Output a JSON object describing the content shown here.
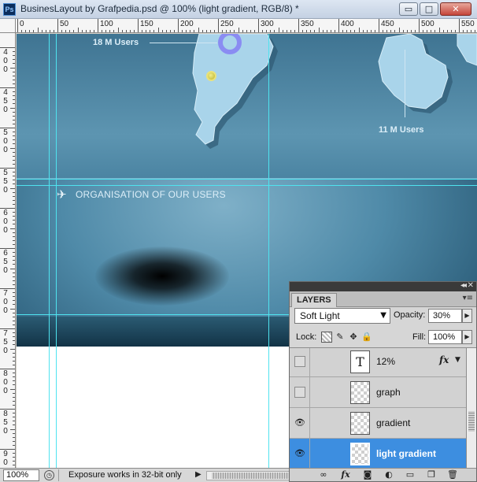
{
  "window": {
    "app_icon": "Ps",
    "title": "BusinesLayout by Grafpedia.psd @ 100% (light gradient, RGB/8) *",
    "minimize_glyph": "▭",
    "maximize_glyph": "□",
    "close_glyph": "✕"
  },
  "rulers": {
    "top_labels": [
      "0",
      "50",
      "100",
      "150",
      "200",
      "250",
      "300",
      "350",
      "400",
      "450",
      "500",
      "550"
    ],
    "left_labels": [
      [
        "4",
        "0",
        "0"
      ],
      [
        "4",
        "5",
        "0"
      ],
      [
        "5",
        "0",
        "0"
      ],
      [
        "5",
        "5",
        "0"
      ],
      [
        "6",
        "0",
        "0"
      ],
      [
        "6",
        "5",
        "0"
      ],
      [
        "7",
        "0",
        "0"
      ],
      [
        "7",
        "5",
        "0"
      ],
      [
        "8",
        "0",
        "0"
      ],
      [
        "8",
        "5",
        "0"
      ],
      [
        "9",
        "0",
        "0"
      ]
    ]
  },
  "canvas": {
    "label_18m": "18 M Users",
    "label_11m": "11 M Users",
    "org_icon": "✈",
    "org_title": "ORGANISATION OF OUR USERS"
  },
  "statusbar": {
    "zoom": "100%",
    "icon": "◷",
    "message": "Exposure works in 32-bit only",
    "arrow": "▶"
  },
  "layers_panel": {
    "collapse_glyph": "◂◂",
    "close_glyph": "✕",
    "tab_label": "LAYERS",
    "menu_glyph": "▾≡",
    "blend_mode": "Soft Light",
    "blend_arrow": "▼",
    "opacity_label": "Opacity:",
    "opacity_value": "30%",
    "lock_label": "Lock:",
    "fill_label": "Fill:",
    "fill_value": "100%",
    "stepper_glyph": "▶",
    "lock_icons": {
      "pixels": "✎",
      "position": "✥",
      "all": "🔒"
    },
    "layers": [
      {
        "name": "12%",
        "visible": false,
        "kind": "text",
        "thumb_glyph": "T",
        "fx": "fx",
        "fx_arrow": "▼"
      },
      {
        "name": "graph",
        "visible": false,
        "kind": "pixel"
      },
      {
        "name": "gradient",
        "visible": true,
        "kind": "pixel"
      },
      {
        "name": "light gradient",
        "visible": true,
        "kind": "pixel",
        "selected": true
      }
    ],
    "eye_glyph": "👁",
    "footer": {
      "link": "∞",
      "fx": "fx",
      "mask": "◙",
      "adjust": "◐",
      "group": "▭",
      "new": "❐",
      "trash": "🗑"
    }
  },
  "colors": {
    "selected_layer": "#3d8ee0",
    "guide": "#4fe3ef",
    "ring": "#8a8cf2"
  }
}
